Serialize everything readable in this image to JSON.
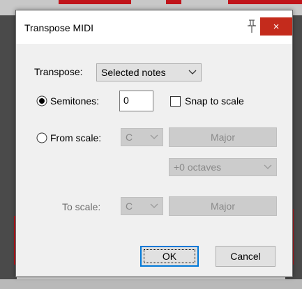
{
  "dialog": {
    "title": "Transpose MIDI",
    "close_glyph": "×",
    "pin_icon": "pin-icon"
  },
  "transpose": {
    "label": "Transpose:",
    "selected": "Selected notes"
  },
  "semitones": {
    "label": "Semitones:",
    "selected": true,
    "value": "0"
  },
  "snap": {
    "label": "Snap to scale",
    "checked": false
  },
  "from_scale": {
    "label": "From scale:",
    "selected": false,
    "root": "C",
    "scale": "Major",
    "octaves": "+0 octaves"
  },
  "to_scale": {
    "label": "To scale:",
    "root": "C",
    "scale": "Major"
  },
  "buttons": {
    "ok": "OK",
    "cancel": "Cancel"
  },
  "colors": {
    "close": "#c42b1c",
    "focus_border": "#0078d7",
    "track_red": "#c0141a"
  }
}
